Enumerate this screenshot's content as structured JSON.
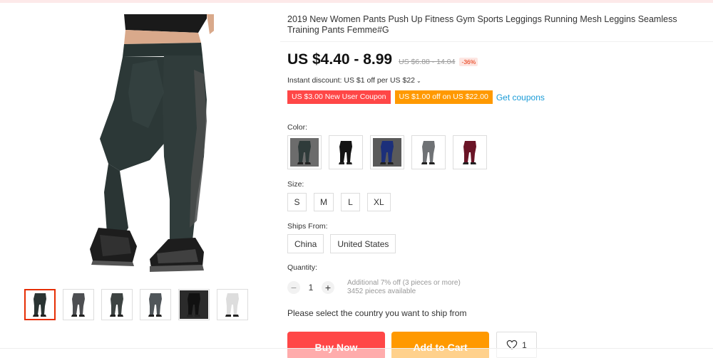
{
  "product": {
    "title": "2019 New Women Pants Push Up Fitness Gym Sports Leggings Running Mesh Leggins Seamless Training Pants Femme#G",
    "price": "US $4.40 - 8.99",
    "original_price": "US $6.88 - 14.04",
    "discount": "-36%"
  },
  "promo": {
    "instant_discount": "Instant discount: US $1 off per US $22",
    "chevron": "⌄",
    "coupons": [
      "US $3.00 New User Coupon",
      "US $1.00 off on US $22.00"
    ],
    "get_coupons": "Get coupons"
  },
  "color": {
    "label": "Color:",
    "options": [
      {
        "color": "#2f3b3a",
        "bg": "#6c6c6c"
      },
      {
        "color": "#141414",
        "bg": "#ffffff"
      },
      {
        "color": "#1c2f7a",
        "bg": "#5a5a5a"
      },
      {
        "color": "#6f7275",
        "bg": "#ffffff"
      },
      {
        "color": "#6a1426",
        "bg": "#ffffff"
      }
    ]
  },
  "size": {
    "label": "Size:",
    "options": [
      "S",
      "M",
      "L",
      "XL"
    ]
  },
  "ships_from": {
    "label": "Ships From:",
    "options": [
      "China",
      "United States"
    ]
  },
  "quantity": {
    "label": "Quantity:",
    "minus": "−",
    "plus": "+",
    "value": "1",
    "note_discount": "Additional 7% off (3 pieces or more)",
    "note_available": "3452 pieces available"
  },
  "shipping_message": "Please select the country you want to ship from",
  "actions": {
    "buy_now": "Buy Now",
    "add_to_cart": "Add to Cart",
    "wishlist_count": "1"
  },
  "gallery": {
    "thumbnails": [
      {
        "color": "#2a3433",
        "bg": "#ffffff"
      },
      {
        "color": "#4d4f52",
        "bg": "#ffffff"
      },
      {
        "color": "#3d4342",
        "bg": "#ffffff"
      },
      {
        "color": "#50565a",
        "bg": "#ffffff"
      },
      {
        "color": "#111111",
        "bg": "#2b2b2b"
      },
      {
        "color": "#dddddd",
        "bg": "#ffffff"
      }
    ]
  },
  "icons": {
    "heart": "heart-icon",
    "legging": "legging-icon"
  },
  "colors": {
    "accent_red": "#ff4747",
    "accent_orange": "#ff9900",
    "link_blue": "#1a9bd7"
  }
}
